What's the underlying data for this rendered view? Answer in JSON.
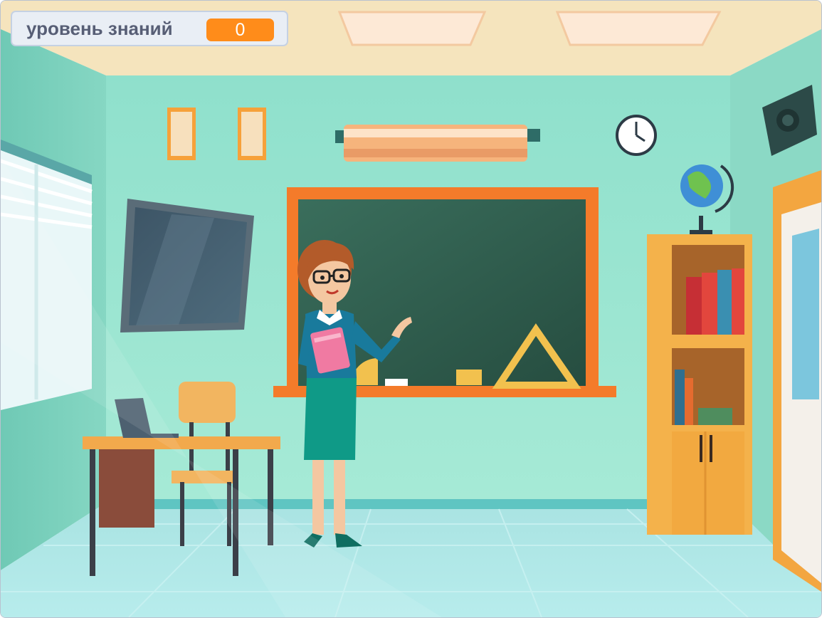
{
  "monitor": {
    "label": "уровень знаний",
    "value": "0",
    "value_color": "#ff8c1a"
  },
  "scene": {
    "backdrop": "classroom",
    "sprites": [
      "teacher"
    ],
    "colors": {
      "wall": "#8fdcc8",
      "ceiling": "#f7e6bf",
      "floor": "#a8e0e2",
      "chalkboard": "#2f5e4d",
      "board_frame": "#f47b2a"
    }
  }
}
